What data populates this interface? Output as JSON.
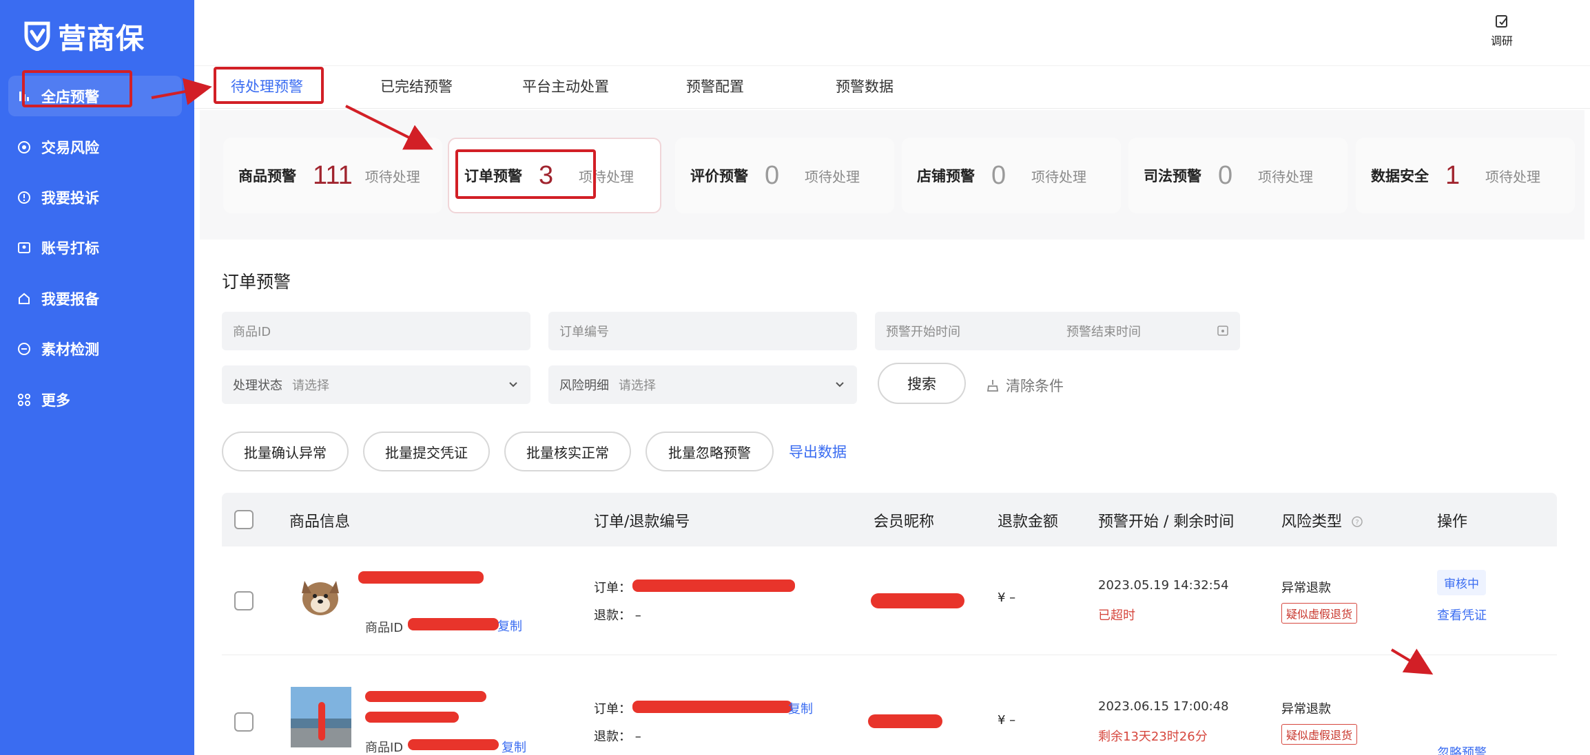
{
  "brand": {
    "name": "营商保"
  },
  "sidebar": {
    "items": [
      {
        "label": "全店预警",
        "icon": "store-alert-icon"
      },
      {
        "label": "交易风险",
        "icon": "transaction-risk-icon"
      },
      {
        "label": "我要投诉",
        "icon": "complaint-icon"
      },
      {
        "label": "账号打标",
        "icon": "account-tag-icon"
      },
      {
        "label": "我要报备",
        "icon": "report-icon"
      },
      {
        "label": "素材检测",
        "icon": "material-check-icon"
      },
      {
        "label": "更多",
        "icon": "more-grid-icon"
      }
    ]
  },
  "header": {
    "survey_label": "调研"
  },
  "tabs": [
    {
      "label": "待处理预警"
    },
    {
      "label": "已完结预警"
    },
    {
      "label": "平台主动处置"
    },
    {
      "label": "预警配置"
    },
    {
      "label": "预警数据"
    }
  ],
  "cards": [
    {
      "label": "商品预警",
      "count": "111",
      "suffix": "项待处理"
    },
    {
      "label": "订单预警",
      "count": "3",
      "suffix": "项待处理"
    },
    {
      "label": "评价预警",
      "count": "0",
      "suffix": "项待处理"
    },
    {
      "label": "店铺预警",
      "count": "0",
      "suffix": "项待处理"
    },
    {
      "label": "司法预警",
      "count": "0",
      "suffix": "项待处理"
    },
    {
      "label": "数据安全",
      "count": "1",
      "suffix": "项待处理"
    }
  ],
  "section": {
    "title": "订单预警"
  },
  "filters": {
    "product_id_placeholder": "商品ID",
    "order_no_placeholder": "订单编号",
    "alert_start_placeholder": "预警开始时间",
    "alert_end_placeholder": "预警结束时间",
    "status_label": "处理状态",
    "status_placeholder": "请选择",
    "risk_label": "风险明细",
    "risk_placeholder": "请选择",
    "search_label": "搜索",
    "clear_label": "清除条件"
  },
  "batch": {
    "confirm_abnormal": "批量确认异常",
    "submit_proof": "批量提交凭证",
    "verify_normal": "批量核实正常",
    "ignore_alert": "批量忽略预警",
    "export": "导出数据"
  },
  "table": {
    "headers": [
      "商品信息",
      "订单/退款编号",
      "会员昵称",
      "退款金额",
      "预警开始 / 剩余时间",
      "风险类型",
      "操作"
    ],
    "rows": [
      {
        "product_id_label": "商品ID",
        "copy_label": "复制",
        "order_label": "订单：",
        "refund_label": "退款：",
        "refund_value": "–",
        "amount": "¥ –",
        "alert_time": "2023.05.19 14:32:54",
        "remaining": "已超时",
        "risk_type": "异常退款",
        "risk_tag": "疑似虚假退货",
        "status": "审核中",
        "action": "查看凭证"
      },
      {
        "product_id_label": "商品ID",
        "copy_label": "复制",
        "order_label": "订单：",
        "order_copy_label": "复制",
        "refund_label": "退款：",
        "refund_value": "–",
        "amount": "¥ –",
        "alert_time": "2023.06.15 17:00:48",
        "remaining": "剩余13天23时26分",
        "risk_type": "异常退款",
        "risk_tag": "疑似虚假退货",
        "action": "忽略预警"
      }
    ]
  },
  "colors": {
    "accent": "#3a6cf1",
    "danger": "#d6473e",
    "count_red": "#a0242e",
    "annotation": "#d21f26"
  }
}
